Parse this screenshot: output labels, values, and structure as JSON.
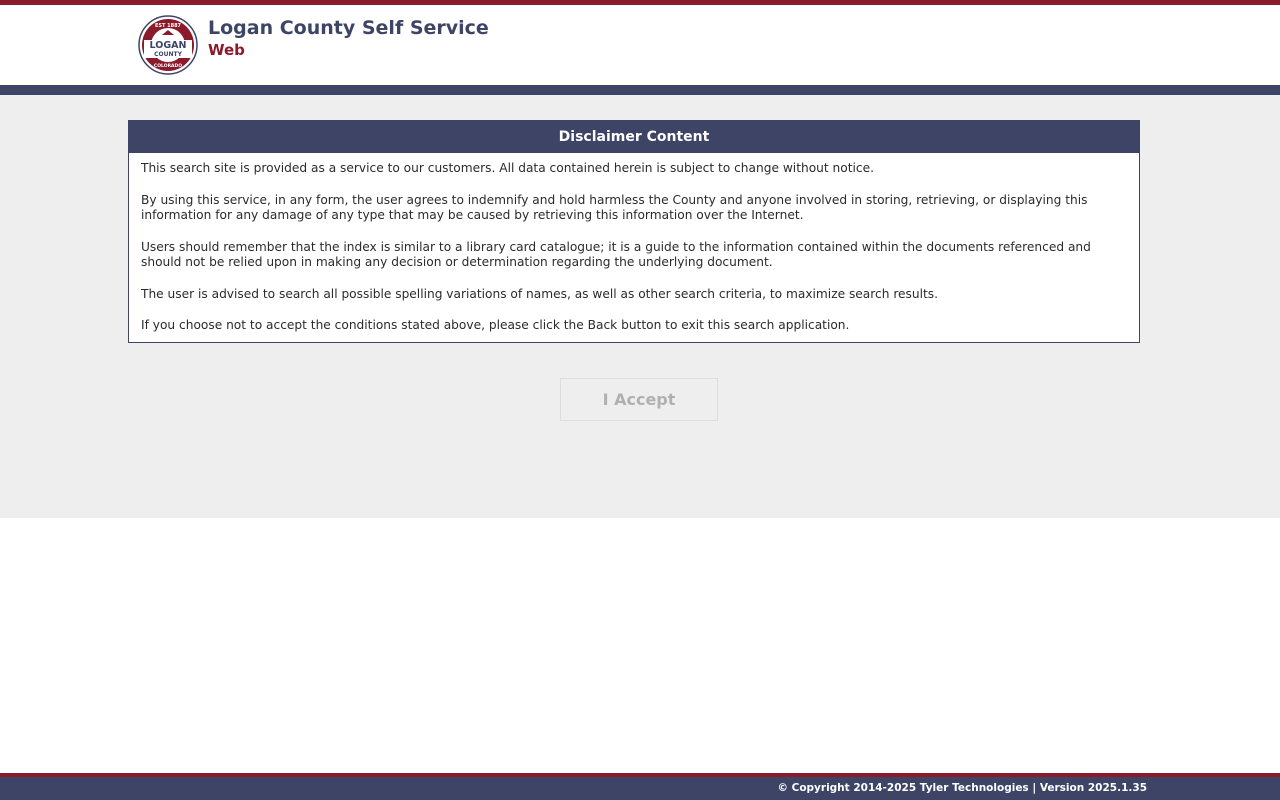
{
  "header": {
    "logo": {
      "icon": "logan-county-seal",
      "top_text": "EST 1887",
      "name_line1": "LOGAN",
      "name_line2": "COUNTY",
      "bottom_text": "COLORADO"
    },
    "title": "Logan County Self Service",
    "subtitle": "Web"
  },
  "disclaimer": {
    "heading": "Disclaimer Content",
    "paragraphs": [
      "This search site is provided as a service to our customers. All data contained herein is subject to change without notice.",
      "By using this service, in any form, the user agrees to indemnify and hold harmless the County and anyone involved in storing, retrieving, or displaying this information for any damage of any type that may be caused by retrieving this information over the Internet.",
      "Users should remember that the index is similar to a library card catalogue; it is a guide to the information contained within the documents referenced and should not be relied upon in making any decision or determination regarding the underlying document.",
      "The user is advised to search all possible spelling variations of names, as well as other search criteria, to maximize search results.",
      "If you choose not to accept the conditions stated above, please click the Back button to exit this search application."
    ]
  },
  "accept_button": {
    "label": "I Accept",
    "state": "disabled"
  },
  "footer": {
    "text": "© Copyright 2014-2025 Tyler Technologies | Version 2025.1.35"
  },
  "colors": {
    "brand_navy": "#3d4466",
    "brand_red": "#8b1a2b",
    "content_bg": "#eeeeee"
  }
}
